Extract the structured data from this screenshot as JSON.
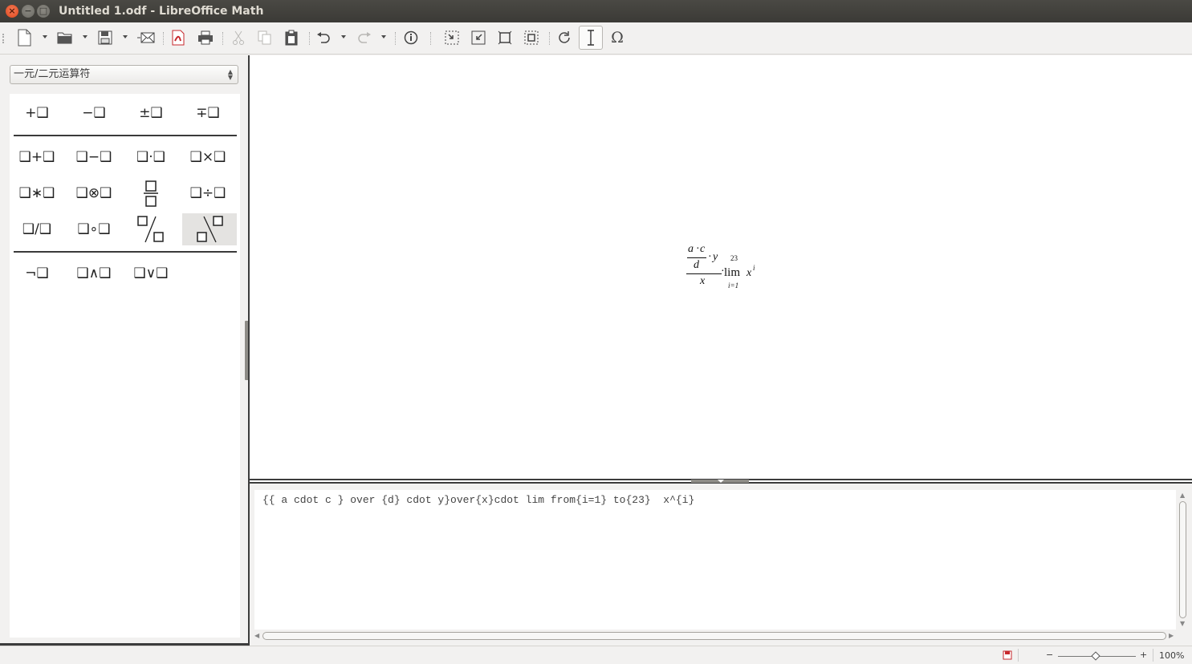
{
  "window": {
    "title": "Untitled 1.odf - LibreOffice Math"
  },
  "sidebar": {
    "category": "一元/二元运算符",
    "unary": [
      {
        "label": "+❑",
        "name": "plus"
      },
      {
        "label": "−❑",
        "name": "minus"
      },
      {
        "label": "±❑",
        "name": "plus-minus"
      },
      {
        "label": "∓❑",
        "name": "minus-plus"
      }
    ],
    "binary": [
      {
        "label": "❑+❑",
        "name": "addition"
      },
      {
        "label": "❑−❑",
        "name": "subtraction"
      },
      {
        "label": "❑·❑",
        "name": "cdot"
      },
      {
        "label": "❑×❑",
        "name": "times"
      },
      {
        "label": "❑∗❑",
        "name": "asterisk"
      },
      {
        "label": "❑⊗❑",
        "name": "otimes"
      },
      {
        "label": "",
        "name": "fraction"
      },
      {
        "label": "❑÷❑",
        "name": "division"
      },
      {
        "label": "❑/❑",
        "name": "slash"
      },
      {
        "label": "❑∘❑",
        "name": "circ"
      },
      {
        "label": "",
        "name": "wideslash"
      },
      {
        "label": "",
        "name": "widebslash"
      }
    ],
    "logic": [
      {
        "label": "¬❑",
        "name": "neg"
      },
      {
        "label": "❑∧❑",
        "name": "and"
      },
      {
        "label": "❑∨❑",
        "name": "or"
      }
    ]
  },
  "formula_preview": {
    "num_a": "a",
    "num_cdot": "·",
    "num_c": "c",
    "den_d": "d",
    "cdot_y": "·",
    "y": "y",
    "x": "x",
    "cdot_lim": "·",
    "upper": "23",
    "lim": "lim",
    "lower": "i=1",
    "base": "x",
    "exp": "i"
  },
  "editor": {
    "text": "{{ a cdot c } over {d} cdot y}over{x}cdot lim from{i=1} to{23}  x^{i}"
  },
  "statusbar": {
    "zoom": "100%",
    "zoom_minus": "−",
    "zoom_plus": "+"
  },
  "icons": {
    "new": "new-document-icon",
    "open": "open-folder-icon",
    "save": "save-icon",
    "email": "email-icon",
    "pdf": "export-pdf-icon",
    "print": "print-icon",
    "cut": "cut-icon",
    "copy": "copy-icon",
    "paste": "paste-icon",
    "undo": "undo-icon",
    "redo": "redo-icon",
    "elements": "info-icon",
    "zoom_in": "zoom-in-icon",
    "zoom_out": "zoom-out-icon",
    "show_all": "show-all-icon",
    "zoom_100": "zoom-100-icon",
    "update": "update-icon",
    "cursor": "formula-cursor-icon",
    "symbols": "omega-icon"
  }
}
